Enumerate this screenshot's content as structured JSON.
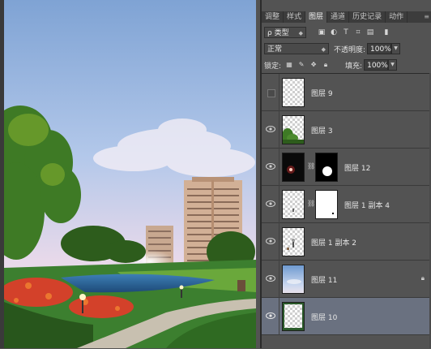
{
  "tabs": [
    {
      "label": "调整",
      "active": false
    },
    {
      "label": "样式",
      "active": false
    },
    {
      "label": "图层",
      "active": true
    },
    {
      "label": "通道",
      "active": false
    },
    {
      "label": "历史记录",
      "active": false
    },
    {
      "label": "动作",
      "active": false
    }
  ],
  "filter": {
    "kind_label": "ρ 类型"
  },
  "blend": {
    "mode": "正常",
    "opacity_label": "不透明度:",
    "opacity_value": "100%"
  },
  "lock": {
    "label": "锁定:",
    "fill_label": "填充:",
    "fill_value": "100%"
  },
  "layers": [
    {
      "name": "图层 9",
      "visible": false,
      "thumb": "blank",
      "mask": false,
      "locked": false,
      "selected": false
    },
    {
      "name": "图层 3",
      "visible": true,
      "thumb": "trees",
      "mask": false,
      "locked": false,
      "selected": false
    },
    {
      "name": "图层 12",
      "visible": true,
      "thumb": "dark-light",
      "mask": true,
      "mask_type": "glow",
      "locked": false,
      "selected": false
    },
    {
      "name": "图层 1 副本 4",
      "visible": true,
      "thumb": "blank-small",
      "mask": true,
      "mask_type": "white-dot",
      "locked": false,
      "selected": false
    },
    {
      "name": "图层 1 副本 2",
      "visible": true,
      "thumb": "lamp",
      "mask": false,
      "locked": false,
      "selected": false
    },
    {
      "name": "图层 11",
      "visible": true,
      "thumb": "sky",
      "mask": false,
      "locked": true,
      "selected": false
    },
    {
      "name": "图层 10",
      "visible": true,
      "thumb": "frame",
      "mask": false,
      "locked": false,
      "selected": true
    }
  ],
  "colors": {
    "selected_row": "#6a7180",
    "panel_bg": "#535353"
  }
}
